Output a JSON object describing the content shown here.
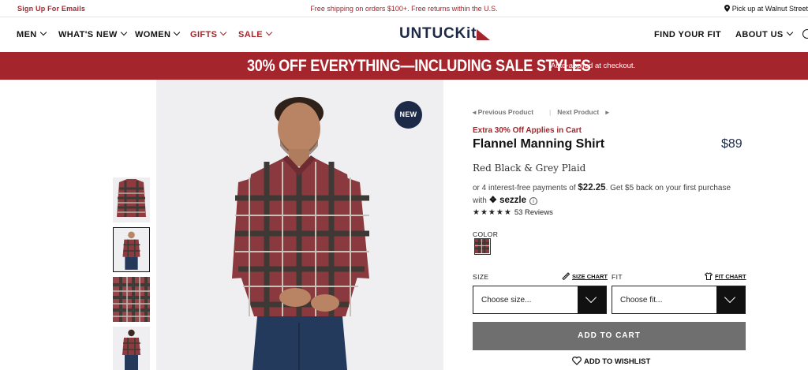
{
  "utility": {
    "signup": "Sign Up For Emails",
    "shipping": "Free shipping on orders $100+. Free returns within the U.S.",
    "pickup": "Pick up at Walnut Street"
  },
  "nav": {
    "men": "MEN",
    "whats_new": "WHAT'S NEW",
    "women": "WOMEN",
    "gifts": "GIFTS",
    "sale": "SALE",
    "logo": "UNTUCKit",
    "find_fit": "FIND YOUR FIT",
    "about": "ABOUT US"
  },
  "promo": {
    "headline": "30% OFF EVERYTHING—INCLUDING SALE STYLES",
    "note": "Auto-applied at checkout."
  },
  "hero": {
    "badge": "NEW"
  },
  "product": {
    "prev": "Previous Product",
    "next": "Next Product",
    "promo_note": "Extra 30% Off Applies in Cart",
    "name": "Flannel Manning Shirt",
    "price": "$89",
    "variant": "Red Black & Grey Plaid",
    "sezzle_line1_prefix": "or 4 interest-free payments of ",
    "sezzle_amount": "$22.25",
    "sezzle_line1_suffix": ". Get $5 back on your first purchase",
    "sezzle_with": "with",
    "sezzle_brand": "sezzle",
    "stars": "★★★★★",
    "reviews": "53 Reviews",
    "rating": 5,
    "color_label": "COLOR",
    "size_label": "SIZE",
    "size_chart": "SIZE CHART",
    "fit_label": "FIT",
    "fit_chart": "FIT CHART",
    "size_placeholder": "Choose size...",
    "fit_placeholder": "Choose fit...",
    "add_to_cart": "ADD TO CART",
    "wishlist": "ADD TO WISHLIST"
  },
  "colors": {
    "brand_red": "#a4262c",
    "navy": "#1d2a47",
    "cart_button": "#6f6f6f"
  }
}
